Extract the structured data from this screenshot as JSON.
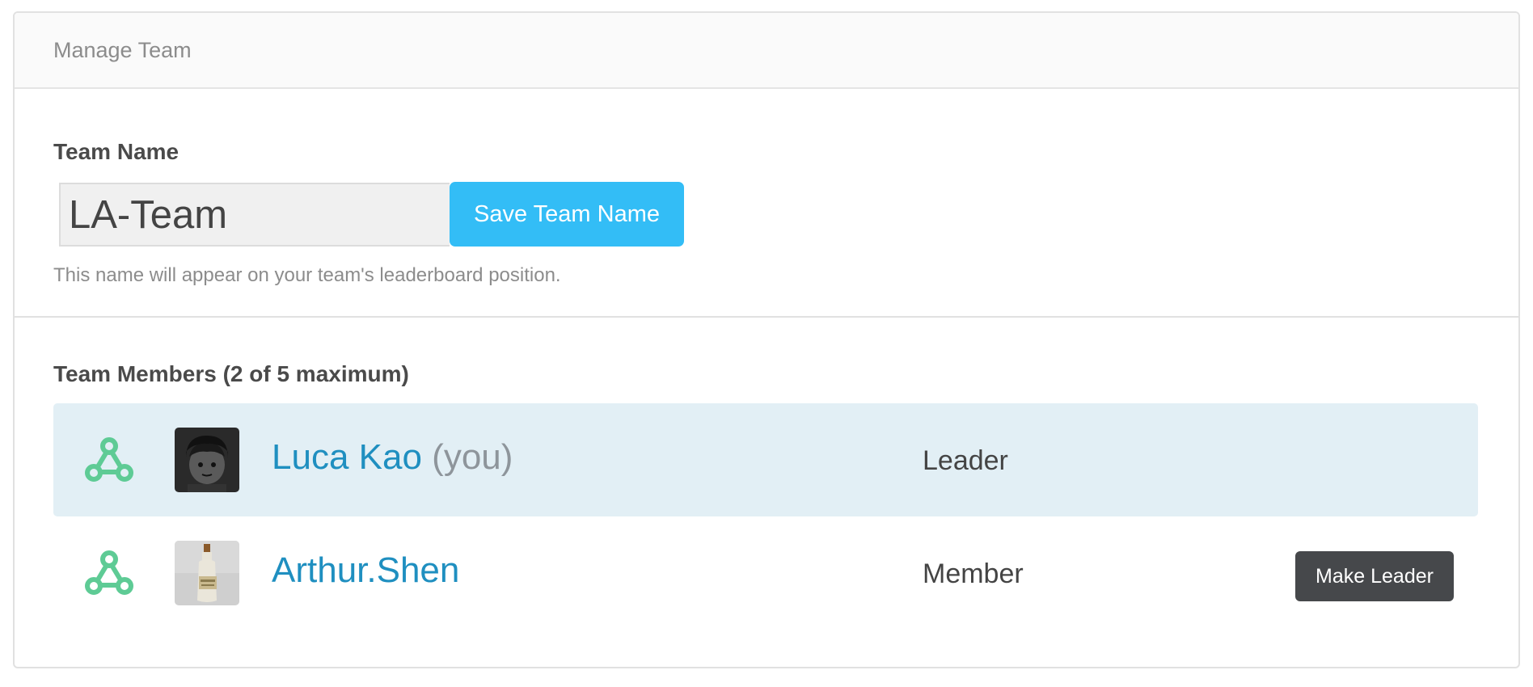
{
  "header": {
    "title": "Manage Team"
  },
  "team_name": {
    "label": "Team Name",
    "value": "LA-Team",
    "save_label": "Save Team Name",
    "help": "This name will appear on your team's leaderboard position."
  },
  "members": {
    "title": "Team Members (2 of 5 maximum)",
    "rows": [
      {
        "name": "Luca Kao",
        "you_tag": "(you)",
        "role": "Leader"
      },
      {
        "name": "Arthur.Shen",
        "role": "Member",
        "action_label": "Make Leader"
      }
    ]
  },
  "colors": {
    "accent": "#33bdf6",
    "link": "#1f8fc0",
    "highlight_row": "#e2eff5",
    "icon_green": "#5ecb95",
    "dark_button": "#46484b"
  },
  "icons": {
    "team_icon": "hub-network-icon"
  }
}
